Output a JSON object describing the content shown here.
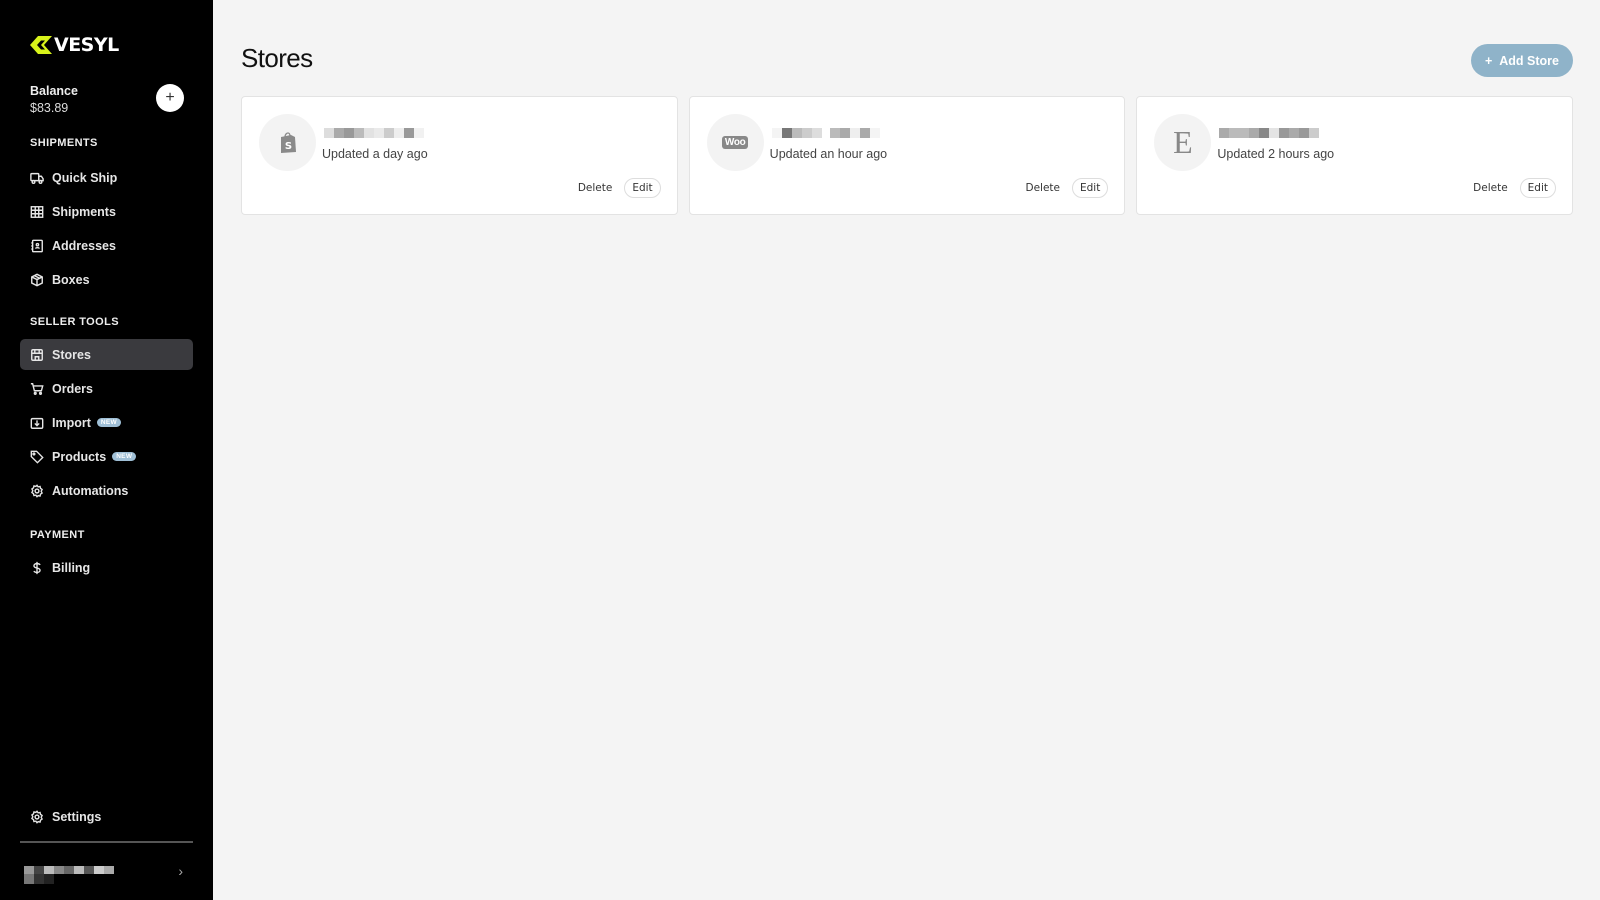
{
  "app": {
    "brand": "VESYL",
    "brand_accent": "#d8f31a"
  },
  "balance": {
    "label": "Balance",
    "amount": "$83.89",
    "add_label": "+"
  },
  "sidebar": {
    "sections": [
      {
        "label": "SHIPMENTS"
      },
      {
        "label": "SELLER TOOLS"
      },
      {
        "label": "PAYMENT"
      }
    ],
    "items": [
      {
        "label": "Quick Ship",
        "icon": "truck-icon"
      },
      {
        "label": "Shipments",
        "icon": "grid-icon"
      },
      {
        "label": "Addresses",
        "icon": "address-book-icon"
      },
      {
        "label": "Boxes",
        "icon": "box-icon"
      },
      {
        "label": "Stores",
        "icon": "store-icon",
        "active": true
      },
      {
        "label": "Orders",
        "icon": "cart-icon"
      },
      {
        "label": "Import",
        "icon": "import-icon",
        "badge": "NEW"
      },
      {
        "label": "Products",
        "icon": "tag-icon",
        "badge": "NEW"
      },
      {
        "label": "Automations",
        "icon": "gear-icon"
      },
      {
        "label": "Billing",
        "icon": "dollar-icon"
      }
    ],
    "settings_label": "Settings",
    "user_chevron": "›"
  },
  "main": {
    "title": "Stores",
    "add_store_label": "Add Store",
    "add_store_icon": "+",
    "add_store_color": "#8fb3c9",
    "stores": [
      {
        "platform": "shopify",
        "updated": "Updated a day ago",
        "delete_label": "Delete",
        "edit_label": "Edit"
      },
      {
        "platform": "woocommerce",
        "logo_text": "Woo",
        "updated": "Updated an hour ago",
        "delete_label": "Delete",
        "edit_label": "Edit"
      },
      {
        "platform": "etsy",
        "logo_text": "E",
        "updated": "Updated 2 hours ago",
        "delete_label": "Delete",
        "edit_label": "Edit"
      }
    ]
  }
}
